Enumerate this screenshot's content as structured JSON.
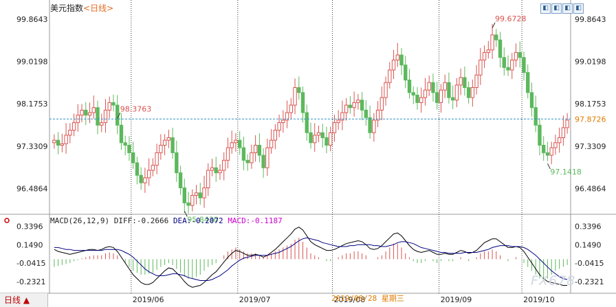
{
  "header": {
    "title": "美元指数",
    "period_badge": "<日线>",
    "buttons": [
      "◧",
      "◧",
      "◧",
      "◧"
    ]
  },
  "price_panel": {
    "y_ticks": [
      "99.8643",
      "99.0198",
      "98.1753",
      "97.3309",
      "96.4864"
    ],
    "current_price": "97.8726",
    "high_label": "99.6728",
    "high_left_label": "98.3763",
    "low_label": "95.8430",
    "low_right_label": "97.1418"
  },
  "macd_panel": {
    "params": "MACD(26,12,9)",
    "diff": "DIFF:-0.2666",
    "dea": "DEA:-0.2072",
    "macd": "MACD:-0.1187",
    "y_ticks": [
      "0.3396",
      "0.1490",
      "-0.0415",
      "-0.2321"
    ]
  },
  "footer": {
    "period_tab": "日线 ▲",
    "x_labels": [
      "2019/06",
      "2019/07",
      "2019/08",
      "2019/09",
      "2019/10"
    ],
    "cursor_date": "2019/08/28 星期三",
    "watermark": "FX678"
  },
  "colors": {
    "up": "#d9534f",
    "down": "#5cb85c",
    "price_line": "#2a8fc6",
    "diff": "#000000",
    "dea": "#000080",
    "macd": "#cc00cc"
  },
  "chart_data": {
    "type": "candlestick",
    "title": "美元指数",
    "ylim": [
      96.0,
      100.0
    ],
    "y_ticks": [
      99.8643,
      99.0198,
      98.1753,
      97.3309,
      96.4864
    ],
    "x_labels": [
      "2019/06",
      "2019/07",
      "2019/08",
      "2019/09",
      "2019/10"
    ],
    "current_price": 97.8726,
    "annotations": [
      {
        "label": "98.3763",
        "type": "local_high"
      },
      {
        "label": "95.8430",
        "type": "low"
      },
      {
        "label": "99.6728",
        "type": "high"
      },
      {
        "label": "97.1418",
        "type": "local_low"
      }
    ],
    "close": [
      97.45,
      97.35,
      97.38,
      97.55,
      97.65,
      97.8,
      97.95,
      98.05,
      97.95,
      98.0,
      98.1,
      97.75,
      97.8,
      98.05,
      98.2,
      98.15,
      97.75,
      97.4,
      97.35,
      97.2,
      97.0,
      96.75,
      96.6,
      96.7,
      96.85,
      96.95,
      97.2,
      97.35,
      97.45,
      97.5,
      97.2,
      96.8,
      96.5,
      96.2,
      96.15,
      96.35,
      96.4,
      96.3,
      96.5,
      96.85,
      96.9,
      96.8,
      96.85,
      97.05,
      97.3,
      97.4,
      97.45,
      97.3,
      97.05,
      97.0,
      97.2,
      97.35,
      97.15,
      96.9,
      97.3,
      97.45,
      97.65,
      97.8,
      97.85,
      98.0,
      98.15,
      98.5,
      98.4,
      98.0,
      97.6,
      97.4,
      97.55,
      97.6,
      97.5,
      97.35,
      97.6,
      97.8,
      97.85,
      98.0,
      98.15,
      98.1,
      98.2,
      98.25,
      98.05,
      97.9,
      97.6,
      97.85,
      98.05,
      98.3,
      98.6,
      98.85,
      99.05,
      99.15,
      98.95,
      98.65,
      98.4,
      98.35,
      98.2,
      98.3,
      98.45,
      98.6,
      98.4,
      98.2,
      98.45,
      98.6,
      98.3,
      98.25,
      98.55,
      98.7,
      98.5,
      98.3,
      98.5,
      98.75,
      99.05,
      99.2,
      99.25,
      99.55,
      99.45,
      99.1,
      98.9,
      98.85,
      99.05,
      99.2,
      99.1,
      98.8,
      98.4,
      98.1,
      97.75,
      97.35,
      97.2,
      97.15,
      97.3,
      97.4,
      97.5,
      97.7,
      97.85
    ],
    "macd_hist": [
      -0.08,
      -0.07,
      -0.06,
      -0.05,
      -0.04,
      -0.02,
      -0.01,
      0.01,
      0.02,
      0.03,
      0.04,
      0.04,
      0.04,
      0.06,
      0.07,
      0.06,
      0.04,
      0.0,
      -0.04,
      -0.08,
      -0.12,
      -0.14,
      -0.16,
      -0.16,
      -0.15,
      -0.14,
      -0.11,
      -0.08,
      -0.06,
      -0.04,
      -0.06,
      -0.1,
      -0.14,
      -0.18,
      -0.2,
      -0.2,
      -0.18,
      -0.16,
      -0.12,
      -0.08,
      -0.06,
      -0.04,
      0.0,
      0.04,
      0.08,
      0.1,
      0.12,
      0.1,
      0.08,
      0.06,
      0.06,
      0.06,
      0.04,
      0.02,
      0.04,
      0.06,
      0.08,
      0.1,
      0.12,
      0.14,
      0.16,
      0.2,
      0.22,
      0.18,
      0.12,
      0.06,
      0.04,
      0.02,
      0.0,
      -0.02,
      -0.02,
      0.0,
      0.02,
      0.04,
      0.06,
      0.06,
      0.08,
      0.08,
      0.06,
      0.04,
      0.0,
      0.0,
      0.02,
      0.04,
      0.08,
      0.12,
      0.16,
      0.16,
      0.12,
      0.06,
      0.02,
      -0.02,
      -0.04,
      -0.04,
      -0.02,
      0.0,
      -0.02,
      -0.04,
      -0.02,
      0.0,
      -0.02,
      -0.02,
      0.0,
      0.02,
      0.0,
      -0.02,
      0.0,
      0.02,
      0.06,
      0.08,
      0.08,
      0.1,
      0.08,
      0.04,
      0.0,
      -0.02,
      0.0,
      0.02,
      0.0,
      -0.04,
      -0.08,
      -0.12,
      -0.16,
      -0.2,
      -0.2,
      -0.2,
      -0.16,
      -0.12,
      -0.1,
      -0.08,
      -0.06
    ],
    "macd_diff": [
      0.1,
      0.08,
      0.07,
      0.06,
      0.05,
      0.06,
      0.07,
      0.08,
      0.09,
      0.1,
      0.1,
      0.09,
      0.1,
      0.12,
      0.13,
      0.12,
      0.08,
      0.02,
      -0.04,
      -0.1,
      -0.16,
      -0.2,
      -0.24,
      -0.26,
      -0.26,
      -0.24,
      -0.2,
      -0.16,
      -0.12,
      -0.09,
      -0.1,
      -0.14,
      -0.18,
      -0.23,
      -0.27,
      -0.29,
      -0.28,
      -0.27,
      -0.24,
      -0.2,
      -0.16,
      -0.13,
      -0.08,
      -0.03,
      0.02,
      0.06,
      0.09,
      0.08,
      0.06,
      0.04,
      0.04,
      0.05,
      0.04,
      0.02,
      0.04,
      0.07,
      0.1,
      0.14,
      0.18,
      0.22,
      0.26,
      0.31,
      0.33,
      0.3,
      0.24,
      0.18,
      0.15,
      0.13,
      0.11,
      0.09,
      0.09,
      0.1,
      0.12,
      0.14,
      0.16,
      0.17,
      0.18,
      0.19,
      0.18,
      0.15,
      0.11,
      0.1,
      0.11,
      0.14,
      0.18,
      0.22,
      0.26,
      0.27,
      0.24,
      0.19,
      0.14,
      0.1,
      0.08,
      0.07,
      0.08,
      0.09,
      0.07,
      0.05,
      0.05,
      0.06,
      0.05,
      0.05,
      0.07,
      0.09,
      0.08,
      0.06,
      0.07,
      0.09,
      0.13,
      0.17,
      0.19,
      0.21,
      0.21,
      0.18,
      0.15,
      0.12,
      0.12,
      0.13,
      0.12,
      0.08,
      0.02,
      -0.04,
      -0.1,
      -0.16,
      -0.2,
      -0.23,
      -0.24,
      -0.25,
      -0.26,
      -0.27,
      -0.27
    ],
    "macd_dea": [
      0.12,
      0.12,
      0.11,
      0.1,
      0.1,
      0.09,
      0.09,
      0.09,
      0.09,
      0.09,
      0.09,
      0.09,
      0.09,
      0.1,
      0.1,
      0.1,
      0.1,
      0.09,
      0.07,
      0.05,
      0.02,
      -0.02,
      -0.06,
      -0.1,
      -0.13,
      -0.15,
      -0.17,
      -0.17,
      -0.17,
      -0.16,
      -0.15,
      -0.15,
      -0.16,
      -0.17,
      -0.19,
      -0.2,
      -0.21,
      -0.22,
      -0.22,
      -0.22,
      -0.21,
      -0.19,
      -0.17,
      -0.14,
      -0.11,
      -0.07,
      -0.04,
      -0.01,
      0.01,
      0.02,
      0.03,
      0.04,
      0.04,
      0.04,
      0.04,
      0.05,
      0.06,
      0.07,
      0.09,
      0.11,
      0.13,
      0.16,
      0.19,
      0.21,
      0.22,
      0.21,
      0.2,
      0.19,
      0.17,
      0.16,
      0.15,
      0.14,
      0.13,
      0.13,
      0.13,
      0.14,
      0.14,
      0.15,
      0.15,
      0.15,
      0.15,
      0.14,
      0.14,
      0.13,
      0.13,
      0.14,
      0.15,
      0.17,
      0.18,
      0.18,
      0.17,
      0.16,
      0.14,
      0.12,
      0.11,
      0.1,
      0.09,
      0.08,
      0.07,
      0.07,
      0.06,
      0.06,
      0.06,
      0.06,
      0.07,
      0.07,
      0.07,
      0.07,
      0.08,
      0.09,
      0.1,
      0.12,
      0.13,
      0.14,
      0.14,
      0.14,
      0.13,
      0.13,
      0.13,
      0.12,
      0.1,
      0.07,
      0.04,
      0.0,
      -0.04,
      -0.08,
      -0.12,
      -0.15,
      -0.18,
      -0.2,
      -0.21
    ]
  }
}
